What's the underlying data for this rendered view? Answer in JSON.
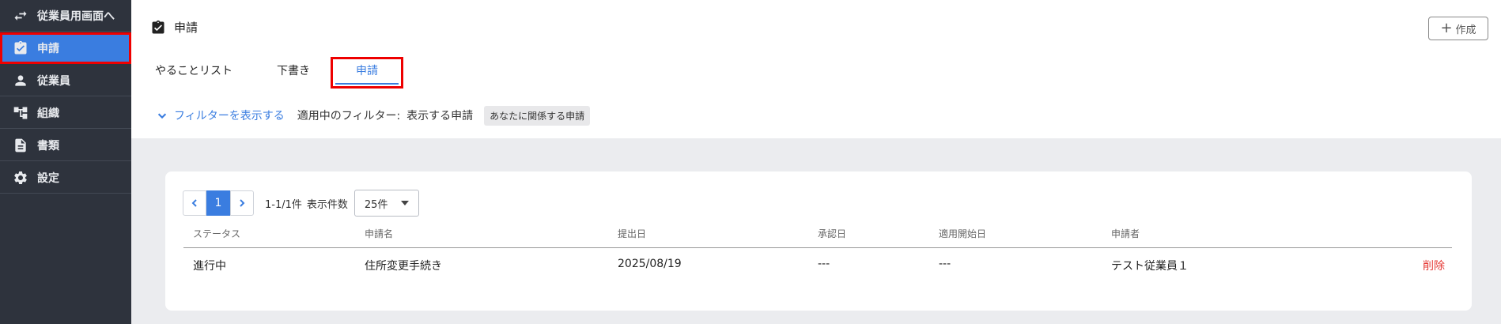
{
  "sidebar": {
    "items": [
      {
        "label": "従業員用画面へ",
        "icon": "swap-arrows-icon"
      },
      {
        "label": "申請",
        "icon": "clipboard-check-icon",
        "active": true
      },
      {
        "label": "従業員",
        "icon": "person-icon"
      },
      {
        "label": "組織",
        "icon": "org-chart-icon"
      },
      {
        "label": "書類",
        "icon": "document-icon"
      },
      {
        "label": "設定",
        "icon": "gear-icon"
      }
    ]
  },
  "header": {
    "title": "申請",
    "create_label": "作成"
  },
  "tabs": [
    {
      "label": "やることリスト"
    },
    {
      "label": "下書き"
    },
    {
      "label": "申請",
      "active": true
    }
  ],
  "filter": {
    "toggle_label": "フィルターを表示する",
    "applied_label": "適用中のフィルター:",
    "display_label": "表示する申請",
    "chip": "あなたに関係する申請"
  },
  "pagination": {
    "current_page": "1",
    "range_text": "1-1/1件",
    "per_page_label": "表示件数",
    "per_page_value": "25件"
  },
  "table": {
    "columns": [
      "ステータス",
      "申請名",
      "提出日",
      "承認日",
      "適用開始日",
      "申請者"
    ],
    "rows": [
      {
        "status": "進行中",
        "name": "住所変更手続き",
        "submitted": "2025/08/19",
        "approved": "---",
        "start": "---",
        "applicant": "テスト従業員１",
        "action": "削除"
      }
    ]
  },
  "colors": {
    "sidebar_bg": "#2e333d",
    "accent": "#3a7de0",
    "danger": "#e53935",
    "highlight": "#ee0000"
  }
}
